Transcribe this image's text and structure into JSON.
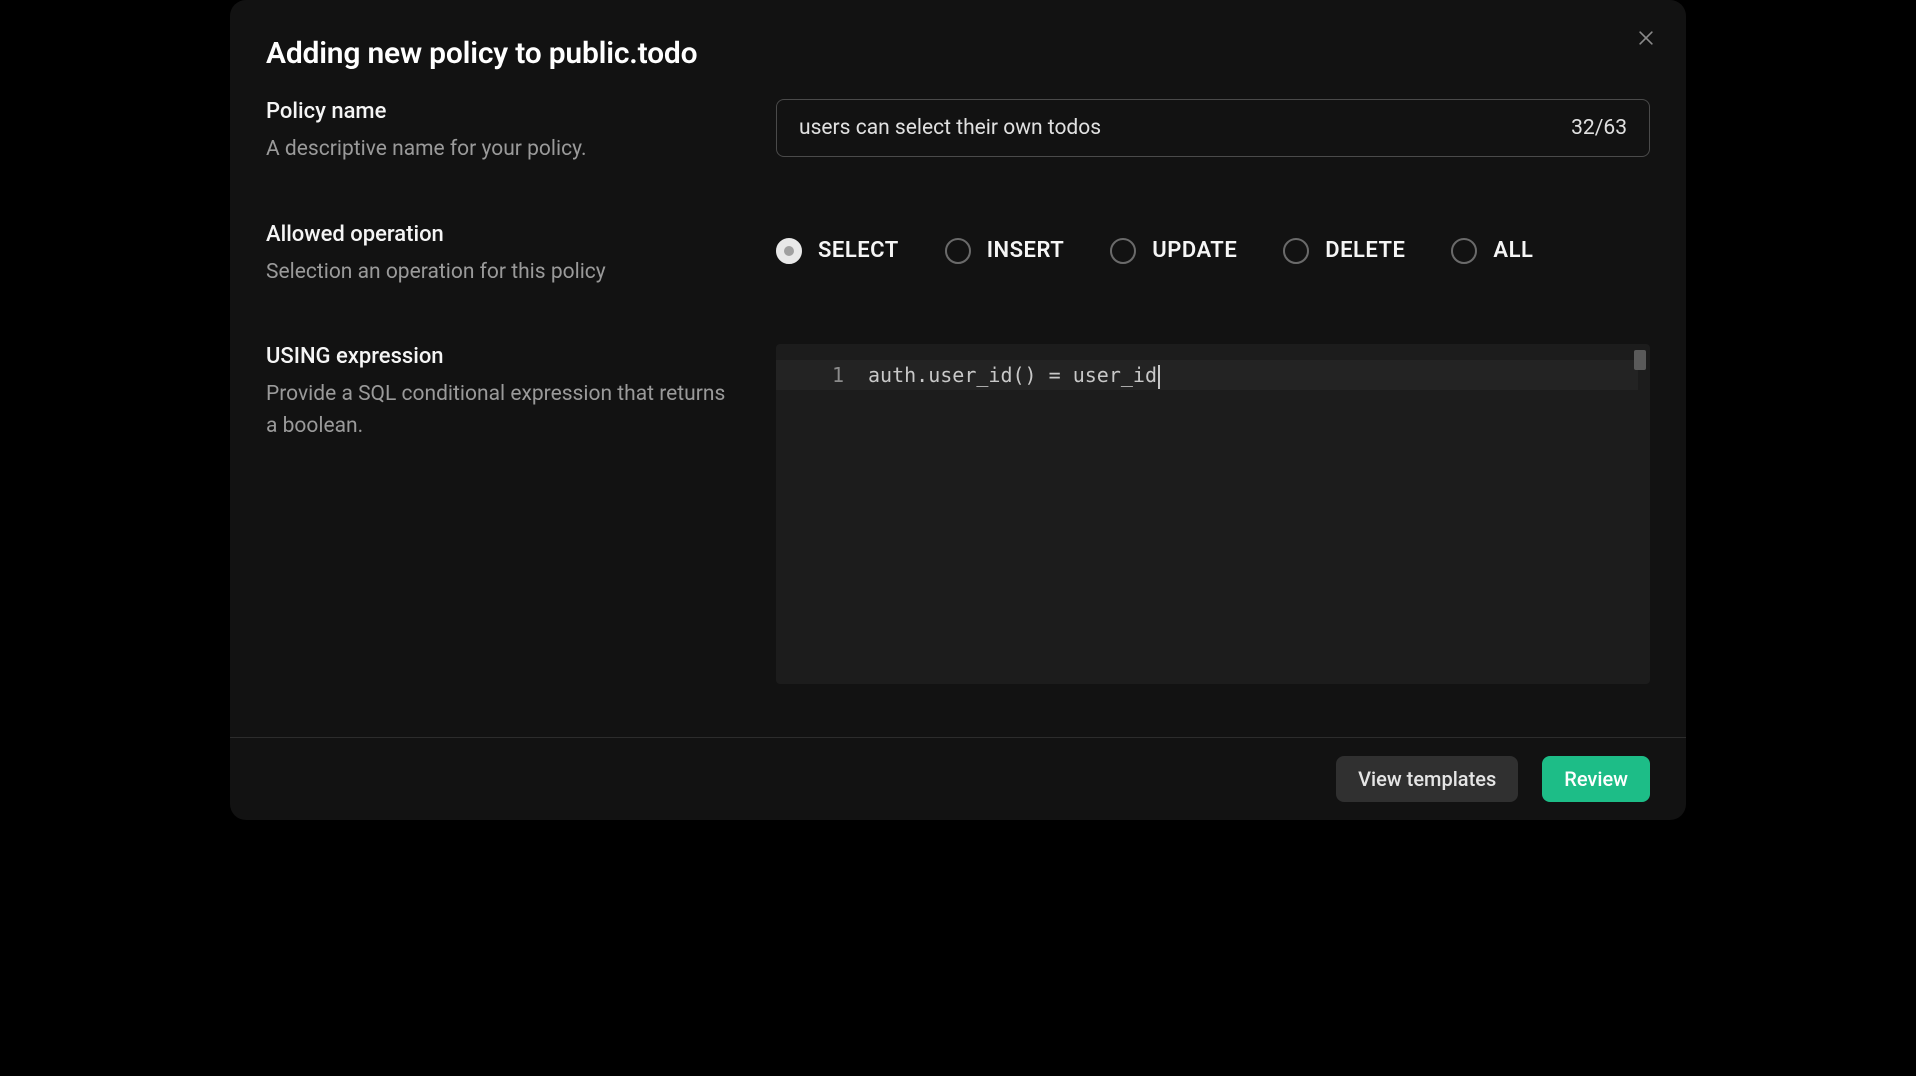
{
  "modal": {
    "title": "Adding new policy to public.todo"
  },
  "fields": {
    "policy_name": {
      "label": "Policy name",
      "description": "A descriptive name for your policy.",
      "value": "users can select their own todos",
      "char_count": "32/63"
    },
    "allowed_operation": {
      "label": "Allowed operation",
      "description": "Selection an operation for this policy",
      "options": [
        {
          "value": "SELECT",
          "selected": true
        },
        {
          "value": "INSERT",
          "selected": false
        },
        {
          "value": "UPDATE",
          "selected": false
        },
        {
          "value": "DELETE",
          "selected": false
        },
        {
          "value": "ALL",
          "selected": false
        }
      ]
    },
    "using_expression": {
      "label": "USING expression",
      "description": "Provide a SQL conditional expression that returns a boolean.",
      "line_number": "1",
      "code": "auth.user_id() = user_id"
    }
  },
  "footer": {
    "view_templates": "View templates",
    "review": "Review"
  }
}
